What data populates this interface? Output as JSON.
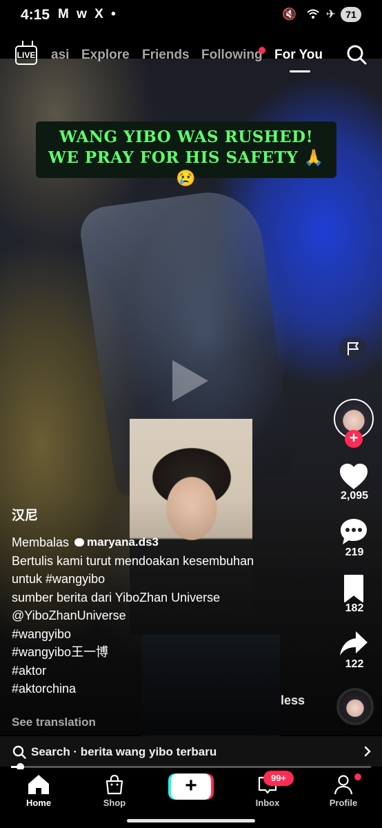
{
  "status_bar": {
    "time": "4:15",
    "left_icons": "M w X •",
    "right_icons": "🔇 ✈",
    "battery": "71"
  },
  "top_nav": {
    "tabs": [
      {
        "label": "asi",
        "active": false
      },
      {
        "label": "Explore",
        "active": false
      },
      {
        "label": "Friends",
        "active": false
      },
      {
        "label": "Following",
        "active": false,
        "has_dot": true
      },
      {
        "label": "For You",
        "active": true
      }
    ],
    "live_label": "LIVE"
  },
  "video": {
    "headline_line1": "WANG YIBO WAS RUSHED!",
    "headline_line2": "WE PRAY FOR HIS SAFETY 🙏😢"
  },
  "right_rail": {
    "like_count": "2,095",
    "comment_count": "219",
    "bookmark_count": "182",
    "share_count": "122"
  },
  "caption": {
    "author": "汉尼",
    "reply_prefix": "Membalas",
    "reply_user": "maryana.ds3",
    "lines": [
      "Bertulis kami turut mendoakan kesembuhan",
      "untuk #wangyibo",
      "sumber berita dari YiboZhan Universe",
      "@YiboZhanUniverse",
      "#wangyibo",
      "#wangyibo王一博",
      "#aktor",
      "#aktorchina"
    ],
    "less_label": "less",
    "see_translation": "See translation"
  },
  "search_bar": {
    "text": "Search · berita wang yibo terbaru"
  },
  "progress": {
    "fraction": 0.02
  },
  "bottom_nav": {
    "home": "Home",
    "shop": "Shop",
    "create": "+",
    "inbox": "Inbox",
    "inbox_badge": "99+",
    "profile": "Profile"
  },
  "colors": {
    "accent_red": "#fe2c55",
    "accent_cyan": "#25f4ee",
    "headline_green": "#5dff6c"
  }
}
